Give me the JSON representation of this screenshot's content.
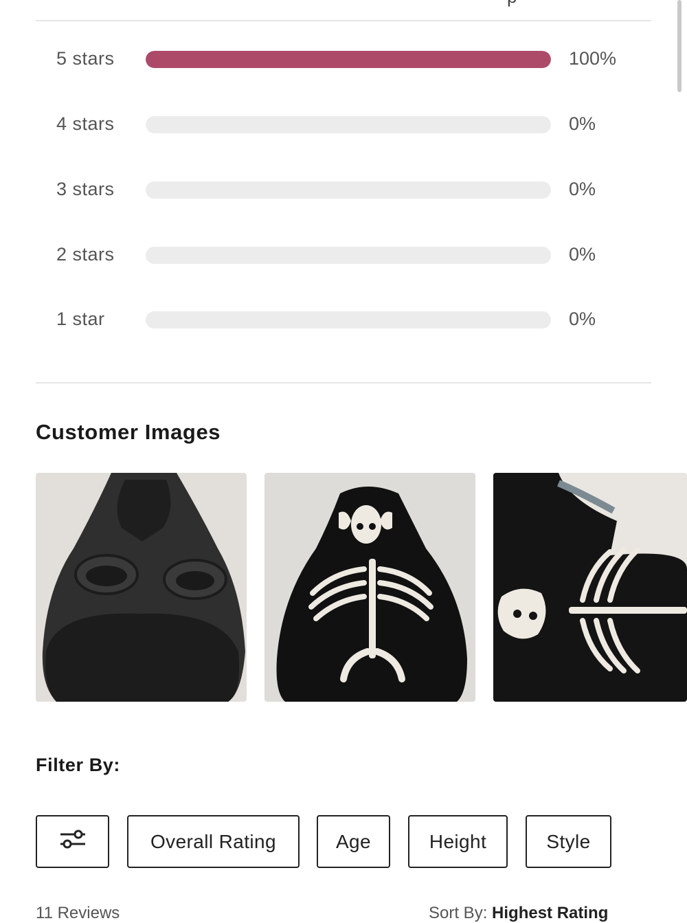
{
  "ratings": [
    {
      "label": "5 stars",
      "percent": 100,
      "percent_text": "100%"
    },
    {
      "label": "4 stars",
      "percent": 0,
      "percent_text": "0%"
    },
    {
      "label": "3 stars",
      "percent": 0,
      "percent_text": "0%"
    },
    {
      "label": "2 stars",
      "percent": 0,
      "percent_text": "0%"
    },
    {
      "label": "1 star",
      "percent": 0,
      "percent_text": "0%"
    }
  ],
  "colors": {
    "bar_fill": "#ad4a6a",
    "bar_track": "#ececec"
  },
  "customer_images": {
    "title": "Customer Images",
    "images": [
      "plain-black-pet-hoodie",
      "skeleton-print-pet-hoodie-front",
      "skeleton-print-pet-hoodie-side"
    ]
  },
  "filter": {
    "title": "Filter By:",
    "icon": "sliders-icon",
    "chips": [
      "Overall Rating",
      "Age",
      "Height",
      "Style"
    ]
  },
  "footer": {
    "reviews_count": "11 Reviews",
    "sort_label": "Sort By:",
    "sort_value": "Highest Rating"
  }
}
